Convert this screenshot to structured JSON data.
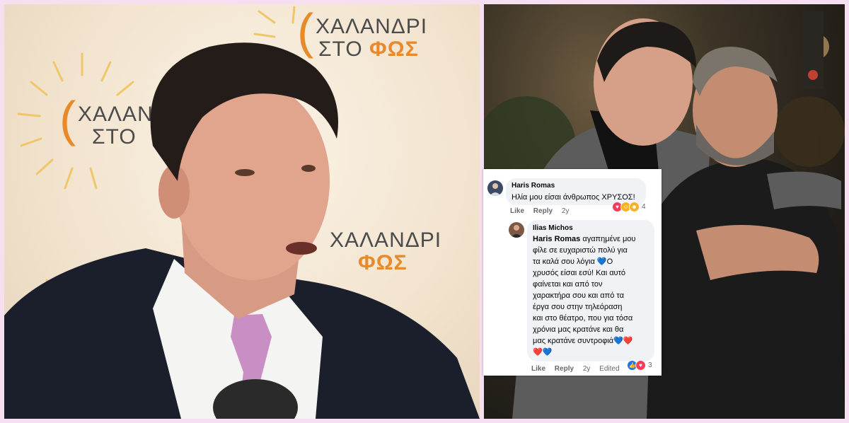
{
  "left_photo": {
    "logo_line1": "ΧΑΛΑΝΔΡΙ",
    "logo_line2_prefix": "ΣΤΟ",
    "logo_line2_accent": "ΦΩΣ",
    "logo_partial_line1": "ΧΑΛΑΝ",
    "logo_partial_line2": "ΣΤΟ",
    "brand_color": "#e98a2a"
  },
  "comments": [
    {
      "author": "Haris Romas",
      "text": "Ηλία μου είσαι άνθρωπος ΧΡΥΣΟΣ!",
      "like": "Like",
      "reply": "Reply",
      "time": "2y",
      "reaction_count": "4"
    },
    {
      "author": "Ilias Michos",
      "mention": "Haris Romas",
      "text_lines": [
        "αγαπημένε μου",
        "φίλε σε ευχαριστώ πολύ για",
        "τα καλά σου λόγια 💙Ο",
        "χρυσός είσαι εσύ! Και αυτό",
        "φαίνεται και από τον",
        "χαρακτήρα σου και από τα",
        "έργα σου στην τηλεόραση",
        "και στο θέατρο, που για τόσα",
        "χρόνια μας κρατάνε και θα",
        "μας κρατάνε συντροφιά💙❤️",
        "❤️💙"
      ],
      "like": "Like",
      "reply": "Reply",
      "time": "2y",
      "edited": "Edited",
      "reaction_count": "3"
    }
  ]
}
